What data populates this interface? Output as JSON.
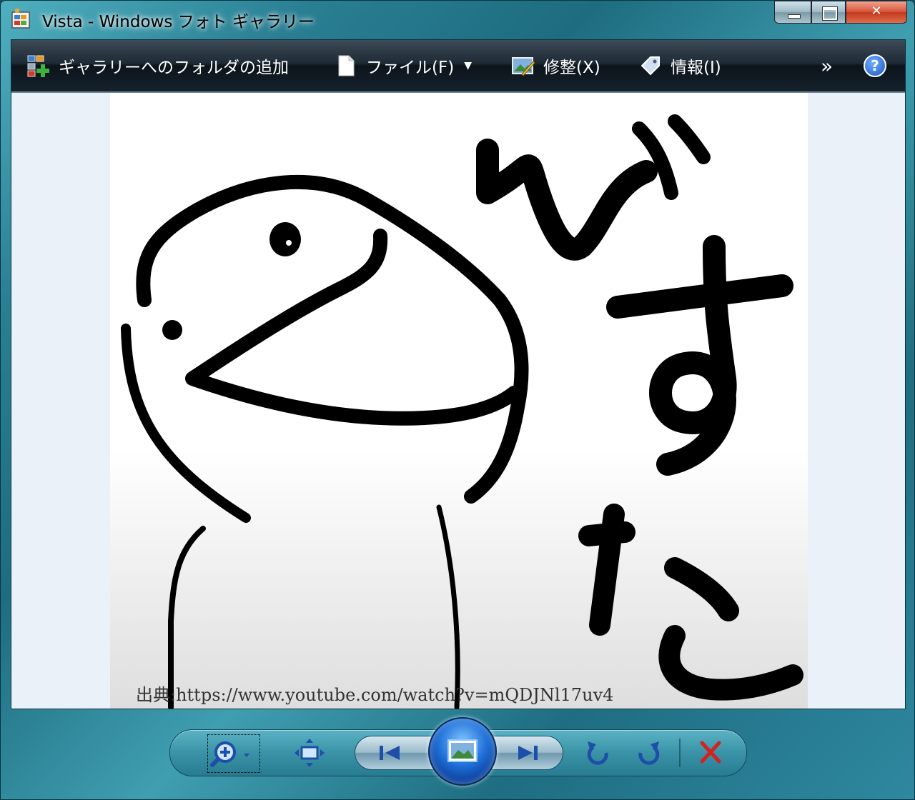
{
  "window": {
    "title": "Vista - Windows フォト ギャラリー"
  },
  "toolbar": {
    "add_folder_label": "ギャラリーへのフォルダの追加",
    "file_label": "ファイル(F)",
    "fix_label": "修整(X)",
    "info_label": "情報(I)",
    "overflow_label": "»",
    "help_label": "?"
  },
  "photo": {
    "caption": "出典:https://www.youtube.com/watch?v=mQDJNl17uv4",
    "drawn_text": "べすた"
  },
  "controls": {
    "items": [
      "zoom",
      "fit-to-window",
      "previous",
      "slideshow",
      "next",
      "rotate-counterclockwise",
      "rotate-clockwise",
      "delete"
    ]
  },
  "colors": {
    "titlebar": "#2a7f93",
    "toolbar": "#1e2a35",
    "close_button": "#d8553a",
    "delete_icon": "#d62020",
    "orb": "#1f6fd7"
  }
}
